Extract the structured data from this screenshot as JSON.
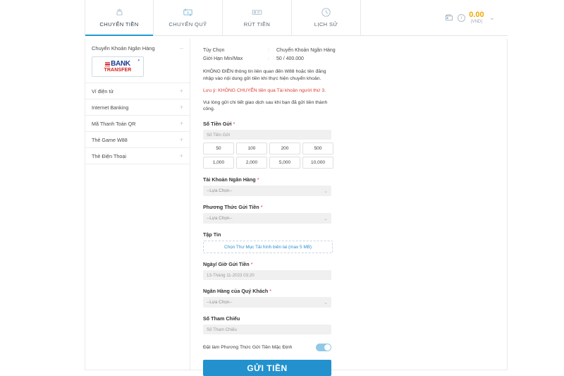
{
  "tabs": [
    {
      "label": "CHUYỂN TIỀN",
      "icon": "hand-coin-icon",
      "active": true
    },
    {
      "label": "CHUYỂN QUỸ",
      "icon": "transfer-funds-icon",
      "active": false
    },
    {
      "label": "RÚT TIỀN",
      "icon": "withdraw-cash-icon",
      "active": false
    },
    {
      "label": "LỊCH SỬ",
      "icon": "clock-history-icon",
      "active": false
    }
  ],
  "balance": {
    "amount": "0.00",
    "currency": "(VND)",
    "wallet_icon": "wallet-icon",
    "info_icon": "info-icon",
    "chevron_icon": "chevron-down-icon"
  },
  "sidebar": {
    "header": {
      "label": "Chuyển Khoản Ngân Hàng",
      "toggle_sign": "–"
    },
    "logo": {
      "bank": "BANK",
      "transfer": "TRANSFER",
      "star": "✦"
    },
    "items": [
      {
        "label": "Ví điện tử",
        "sign": "+"
      },
      {
        "label": "Internet Banking",
        "sign": "+"
      },
      {
        "label": "Mã Thanh Toán QR",
        "sign": "+"
      },
      {
        "label": "Thẻ Game W88",
        "sign": "+"
      },
      {
        "label": "Thẻ Điện Thoại",
        "sign": "+"
      }
    ]
  },
  "main": {
    "info_rows": [
      {
        "key": "Tùy Chọn",
        "sep": ":",
        "value": "Chuyển Khoản Ngân Hàng"
      },
      {
        "key": "Giới Hạn Min/Max",
        "sep": ":",
        "value": "50 / 400.000"
      }
    ],
    "notes": {
      "note1": "KHÔNG ĐIỀN thông tin liên quan đến W88 hoặc tên đăng nhập vào nội dung gửi tiền khi thực hiện chuyển khoản.",
      "warning": "Lưu ý: KHÔNG CHUYỂN tiền qua Tài khoản người thứ 3.",
      "note2": "Vui lòng gửi chi tiết giao dịch sau khi bạn đã gửi tiền thành công."
    },
    "amount": {
      "label": "Số Tiền Gửi",
      "required": "*",
      "placeholder": "Số Tiền Gửi",
      "quick_values": [
        "50",
        "100",
        "200",
        "500",
        "1,000",
        "2,000",
        "5,000",
        "10,000"
      ]
    },
    "bank_account": {
      "label": "Tài Khoản Ngân Hàng",
      "required": "*",
      "value": "--Lựa Chọn--",
      "caret": "⌄"
    },
    "deposit_method": {
      "label": "Phương Thức Gửi Tiền",
      "required": "*",
      "value": "--Lựa Chọn--",
      "caret": "⌄"
    },
    "file": {
      "label": "Tập Tin",
      "button_label": "Chọn Thư Mục Tải hình biên lai (max  5 MB)"
    },
    "datetime": {
      "label": "Ngày/ Giờ Gửi Tiền",
      "required": "*",
      "value": "13-Tháng 11-2023 03:20"
    },
    "customer_bank": {
      "label": "Ngân Hàng của Quý Khách",
      "required": "*",
      "value": "--Lựa Chọn--",
      "caret": "⌄"
    },
    "reference": {
      "label": "Số Tham Chiếu",
      "placeholder": "Số Tham Chiếu"
    },
    "default_toggle": {
      "label": "Đặt làm Phương Thức Gửi Tiền Mặc Định",
      "state": "on"
    },
    "submit_label": "GỬI TIỀN"
  },
  "colors": {
    "accent": "#2291cd",
    "warning": "#e03a2f",
    "balance": "#f0a800",
    "toggle_on": "#8fc9e8"
  }
}
